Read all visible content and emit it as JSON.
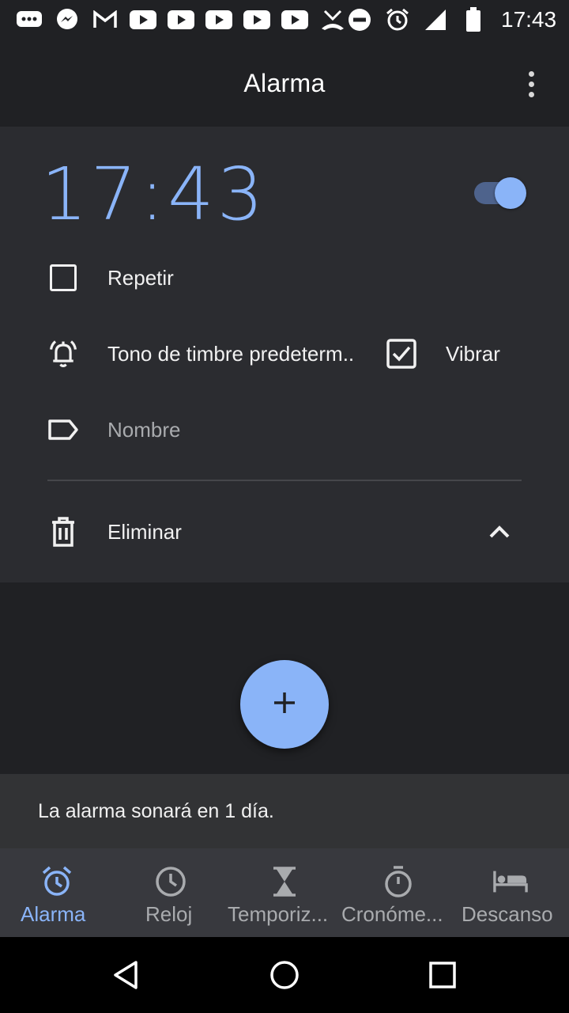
{
  "status_bar": {
    "time": "17:43",
    "left_icons": [
      "chat-icon",
      "messenger-icon",
      "gmail-icon",
      "youtube-icon",
      "youtube-icon",
      "youtube-icon",
      "youtube-icon",
      "youtube-icon",
      "missed-call-icon"
    ],
    "right_icons": [
      "do-not-disturb-icon",
      "alarm-icon",
      "signal-icon",
      "battery-icon"
    ]
  },
  "app_bar": {
    "title": "Alarma",
    "overflow_icon": "more-vert-icon"
  },
  "alarm": {
    "time": "17:43",
    "enabled": true,
    "repeat_label": "Repetir",
    "repeat_checked": false,
    "ringtone_label": "Tono de timbre predeterm..",
    "vibrate_label": "Vibrar",
    "vibrate_checked": true,
    "name_placeholder": "Nombre",
    "delete_label": "Eliminar",
    "collapse_icon": "chevron-up-icon"
  },
  "fab": {
    "icon": "plus-icon"
  },
  "snackbar": {
    "message": "La alarma sonará en 1 día."
  },
  "bottom_nav": {
    "items": [
      {
        "label": "Alarma",
        "icon": "alarm-icon",
        "active": true
      },
      {
        "label": "Reloj",
        "icon": "clock-icon",
        "active": false
      },
      {
        "label": "Temporiz...",
        "icon": "hourglass-icon",
        "active": false
      },
      {
        "label": "Cronóme...",
        "icon": "stopwatch-icon",
        "active": false
      },
      {
        "label": "Descanso",
        "icon": "bed-icon",
        "active": false
      }
    ]
  },
  "system_nav": [
    "back-icon",
    "home-icon",
    "recents-icon"
  ],
  "colors": {
    "accent": "#8ab4f8",
    "background": "#202124",
    "card": "#2b2c30",
    "nav": "#38393e",
    "snackbar": "#323335"
  }
}
